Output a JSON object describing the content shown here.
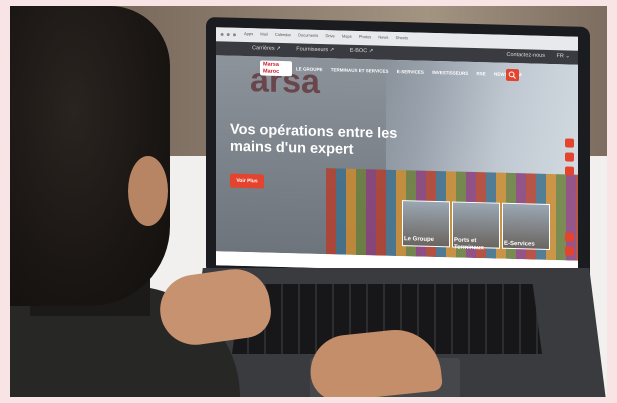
{
  "browser": {
    "bookmarks": [
      "Apps",
      "Mail",
      "Calendar",
      "Documents",
      "Drive",
      "Maps",
      "Photos",
      "News",
      "Sheets"
    ]
  },
  "site": {
    "topbar": {
      "links": [
        "Carrières ↗",
        "Fournisseurs ↗",
        "E-BOC ↗"
      ],
      "contact": "Contactez-nous",
      "language": "FR  ⌄"
    },
    "logo": {
      "line1": "Marsa",
      "line2": "Maroc"
    },
    "wall_text": "arsa",
    "nav": [
      "LE GROUPE",
      "TERMINAUX ET SERVICES",
      "E-SERVICES",
      "INVESTISSEURS",
      "RSE",
      "NEWSROOM"
    ],
    "hero": {
      "headline": "Vos opérations entre les mains d'un expert",
      "cta": "Voir Plus"
    },
    "tiles": [
      {
        "label": "Le Groupe"
      },
      {
        "label": "Ports et Terminaux"
      },
      {
        "label": "E-Services"
      }
    ],
    "accent": "#e4432e"
  }
}
